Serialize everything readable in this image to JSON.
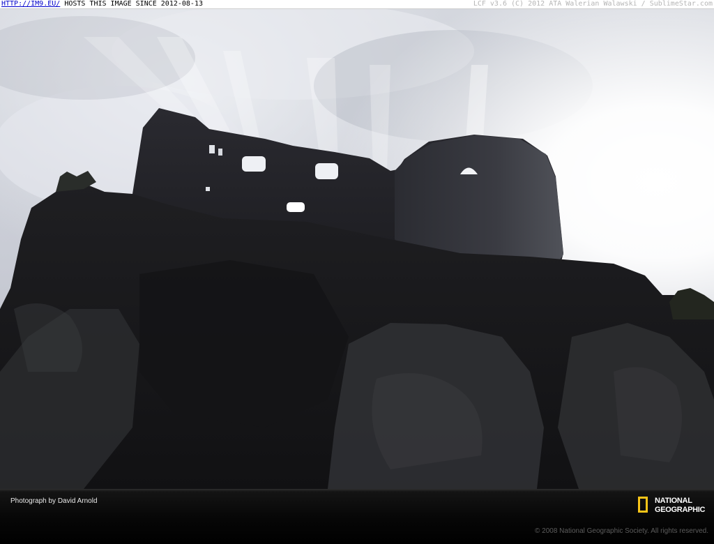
{
  "banner": {
    "link_text": "HTTP://IM9.EU/",
    "host_text": " HOSTS THIS IMAGE SINCE 2012-08-13",
    "version_text": "LCF v3.6 (C) 2012 ATA Walerian Walawski / SublimeStar.com"
  },
  "photo": {
    "icon": "castle-ruin-photo"
  },
  "footer": {
    "credit": "Photograph by David Arnold",
    "logo_line1": "NATIONAL",
    "logo_line2": "GEOGRAPHIC",
    "copyright": "© 2008 National Geographic Society. All rights reserved."
  },
  "colors": {
    "logo_yellow": "#f7c418",
    "banner_link": "#0000cc",
    "sky": "#dcdfe6"
  }
}
